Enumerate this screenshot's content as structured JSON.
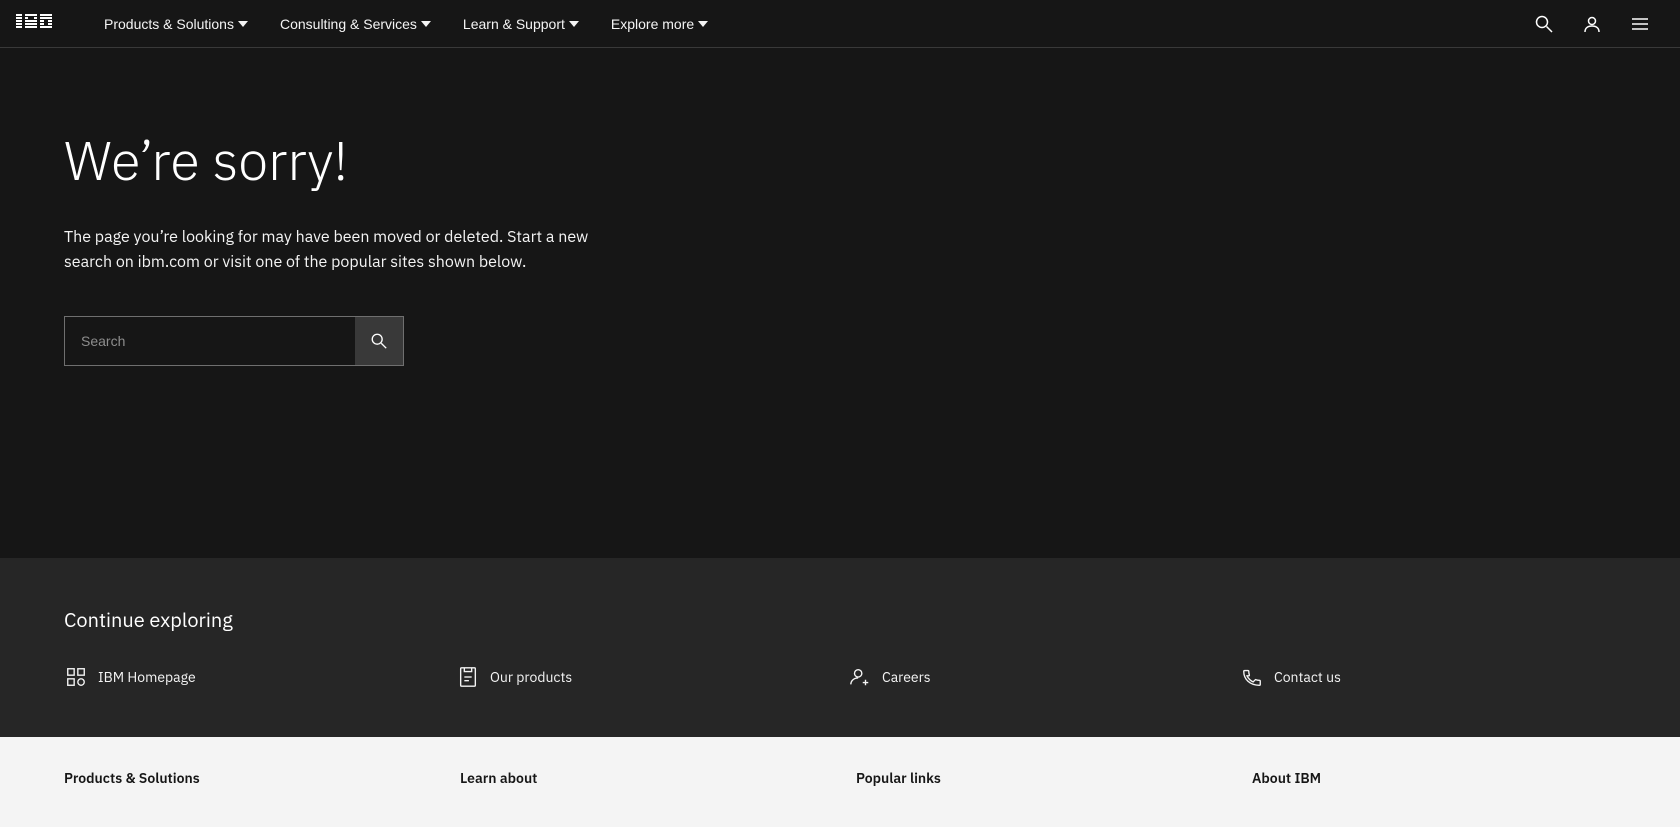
{
  "nav": {
    "logo_alt": "IBM",
    "links": [
      {
        "label": "Products & Solutions",
        "id": "products-solutions"
      },
      {
        "label": "Consulting & Services",
        "id": "consulting-services"
      },
      {
        "label": "Learn & Support",
        "id": "learn-support"
      },
      {
        "label": "Explore more",
        "id": "explore-more"
      }
    ],
    "actions": {
      "search_title": "Search",
      "user_title": "User account",
      "menu_title": "Open menu"
    }
  },
  "hero": {
    "heading": "We’re sorry!",
    "body": "The page you’re looking for may have been moved or deleted. Start a new search on ibm.com or visit one of the popular sites shown below.",
    "search_placeholder": "Search"
  },
  "continue": {
    "heading": "Continue exploring",
    "links": [
      {
        "label": "IBM Homepage",
        "id": "ibm-homepage",
        "icon": "building-icon"
      },
      {
        "label": "Our products",
        "id": "our-products",
        "icon": "products-icon"
      },
      {
        "label": "Careers",
        "id": "careers",
        "icon": "careers-icon"
      },
      {
        "label": "Contact us",
        "id": "contact-us",
        "icon": "phone-icon"
      }
    ]
  },
  "footer": {
    "columns": [
      {
        "heading": "Products & Solutions",
        "id": "footer-products"
      },
      {
        "heading": "Learn about",
        "id": "footer-learn"
      },
      {
        "heading": "Popular links",
        "id": "footer-popular"
      },
      {
        "heading": "About IBM",
        "id": "footer-about"
      }
    ]
  }
}
